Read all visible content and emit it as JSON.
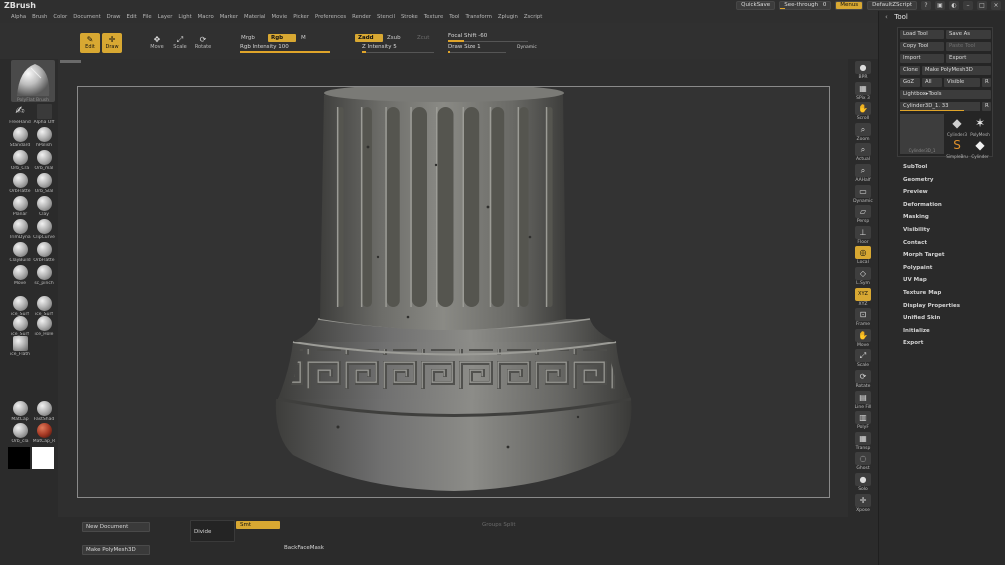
{
  "app": {
    "title": "ZBrush"
  },
  "menu": [
    "Alpha",
    "Brush",
    "Color",
    "Document",
    "Draw",
    "Edit",
    "File",
    "Layer",
    "Light",
    "Macro",
    "Marker",
    "Material",
    "Movie",
    "Picker",
    "Preferences",
    "Render",
    "Stencil",
    "Stroke",
    "Texture",
    "Tool",
    "Transform",
    "Zplugin",
    "Zscript"
  ],
  "topbar": {
    "quicksave": "QuickSave",
    "see_through_label": "See-through",
    "see_through_value": "0",
    "see_through_level": 0.1,
    "menus": "Menus",
    "default_script": "DefaultZScript"
  },
  "toolbar": {
    "edit": "Edit",
    "draw": "Draw",
    "move": "Move",
    "scale": "Scale",
    "rotate": "Rotate",
    "mrgb": "Mrgb",
    "rgb": "Rgb",
    "m": "M",
    "rgb_intensity_label": "Rgb Intensity",
    "rgb_intensity_value": "100",
    "rgb_intensity_fraction": 1.0,
    "zadd": "Zadd",
    "zsub": "Zsub",
    "zcut": "Zcut",
    "z_intensity_label": "Z Intensity",
    "z_intensity_value": "5",
    "z_intensity_fraction": 0.05,
    "focal_shift_label": "Focal Shift",
    "focal_shift_value": "-60",
    "focal_shift_fraction": 0.2,
    "draw_size_label": "Draw Size",
    "draw_size_value": "1",
    "draw_size_fraction": 0.01,
    "dynamic": "Dynamic"
  },
  "left_tray": {
    "current_brush": "PolyFlat Brush",
    "brushes": [
      "FreeHand",
      "Alpha Off",
      "Standard",
      "hPolish",
      "Orb_Cra",
      "Orb_mal",
      "OrbFlatte",
      "Orb_Slal",
      "Planar",
      "Clay",
      "TrimDyna",
      "ClipCurve",
      "ClayBuild",
      "OrbFlatte",
      "Move",
      "sc_pinch",
      "ice_Surf",
      "ice_Surf",
      "ice_Surf",
      "ice_Hole",
      "ice_Flath"
    ],
    "materials": [
      "MatCap",
      "FastShad",
      "Orb_cla",
      "MatCap_R"
    ],
    "colors": {
      "main": "#000000",
      "secondary": "#ffffff"
    }
  },
  "right_shelf": [
    "BPR",
    "SPix 3",
    "Scroll",
    "Zoom",
    "Actual",
    "AAHalf",
    "Dynamic",
    "Persp",
    "Floor",
    "Local",
    "L.Sym",
    "XYZ",
    "Frame",
    "Move",
    "Scale",
    "Rotate",
    "Line Fill",
    "PolyF",
    "Transp",
    "Ghost",
    "Solo",
    "Xpose"
  ],
  "tool_palette": {
    "title": "Tool",
    "load_tool": "Load Tool",
    "save_as": "Save As",
    "copy_tool": "Copy Tool",
    "paste_tool": "Paste Tool",
    "import": "Import",
    "export": "Export",
    "clone": "Clone",
    "make_polymesh": "Make PolyMesh3D",
    "goz": "GoZ",
    "all": "All",
    "visible": "Visible",
    "r": "R",
    "lightbox_tools": "Lightbox▸Tools",
    "current_tool": "Cylinder3D_1. 33",
    "current_tool_fraction": 0.8,
    "thumb_label": "Cylinder3D_1",
    "thumbs": [
      "Cylinder3",
      "PolyMesh",
      "SimpleBru",
      "Cylinder"
    ],
    "subpalettes": [
      "SubTool",
      "Geometry",
      "Preview",
      "Deformation",
      "Masking",
      "Visibility",
      "Contact",
      "Morph Target",
      "Polypaint",
      "UV Map",
      "Texture Map",
      "Display Properties",
      "Unified Skin",
      "Initialize",
      "Export"
    ]
  },
  "bottom_tray": {
    "new_document": "New Document",
    "make_polymesh": "Make PolyMesh3D",
    "divide": "Divide",
    "smt": "Smt",
    "groups_split": "Groups Split",
    "backface_mask": "BackFaceMask"
  }
}
